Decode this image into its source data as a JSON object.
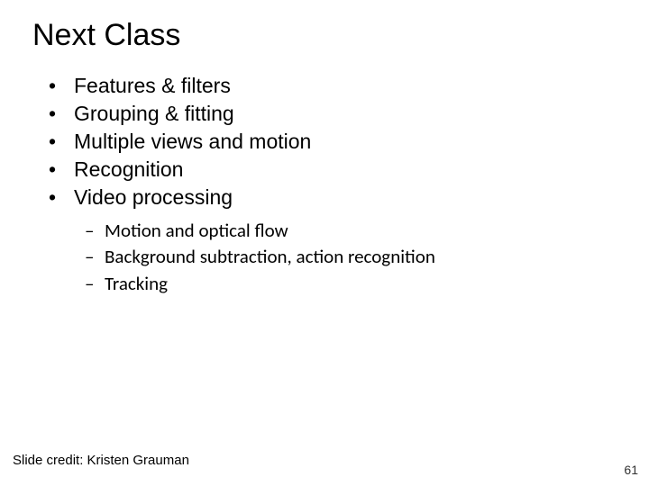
{
  "title": "Next Class",
  "bullets": [
    "Features & filters",
    "Grouping & fitting",
    "Multiple views and motion",
    "Recognition",
    "Video processing"
  ],
  "sublist": [
    "Motion and optical flow",
    "Background subtraction, action recognition",
    "Tracking"
  ],
  "credit": "Slide credit: Kristen Grauman",
  "page_number": "61"
}
